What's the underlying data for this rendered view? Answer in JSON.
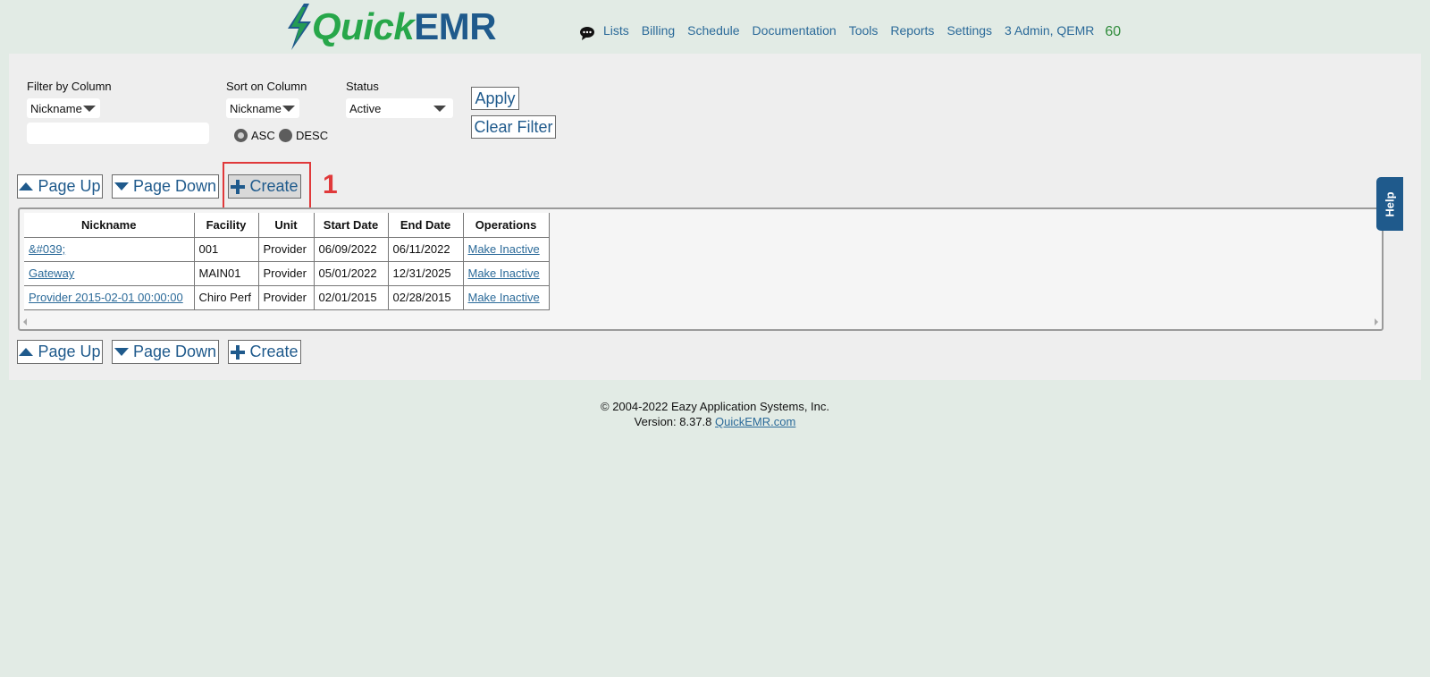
{
  "brand": {
    "quick": "Quick",
    "emr": "EMR",
    "bolt_color": "#1f5a8c",
    "quick_color": "#27a74a"
  },
  "nav": {
    "items": [
      "Lists",
      "Billing",
      "Schedule",
      "Documentation",
      "Tools",
      "Reports",
      "Settings"
    ],
    "user": "3 Admin, QEMR",
    "count": "60"
  },
  "filters": {
    "filter_label": "Filter by Column",
    "filter_value": "Nickname",
    "filter_text": "",
    "sort_label": "Sort on Column",
    "sort_value": "Nickname",
    "asc_label": "ASC",
    "desc_label": "DESC",
    "sort_order": "ASC",
    "status_label": "Status",
    "status_value": "Active",
    "apply_label": "Apply",
    "clear_label": "Clear Filter"
  },
  "toolbar": {
    "page_up": "Page Up",
    "page_down": "Page Down",
    "create": "Create"
  },
  "annotation": {
    "marker": "1",
    "color": "#e0393a"
  },
  "table": {
    "headers": [
      "Nickname",
      "Facility",
      "Unit",
      "Start Date",
      "End Date",
      "Operations"
    ],
    "rows": [
      {
        "nickname": "&#039;",
        "facility": "001",
        "unit": "Provider",
        "start": "06/09/2022",
        "end": "06/11/2022",
        "operation": "Make Inactive"
      },
      {
        "nickname": "Gateway",
        "facility": "MAIN01",
        "unit": "Provider",
        "start": "05/01/2022",
        "end": "12/31/2025",
        "operation": "Make Inactive"
      },
      {
        "nickname": "Provider 2015-02-01 00:00:00",
        "facility": "Chiro Perf",
        "unit": "Provider",
        "start": "02/01/2015",
        "end": "02/28/2015",
        "operation": "Make Inactive"
      }
    ]
  },
  "help": {
    "label": "Help"
  },
  "footer": {
    "copyright": "© 2004-2022 Eazy Application Systems, Inc.",
    "version": "Version: 8.37.8",
    "link": "QuickEMR.com"
  }
}
